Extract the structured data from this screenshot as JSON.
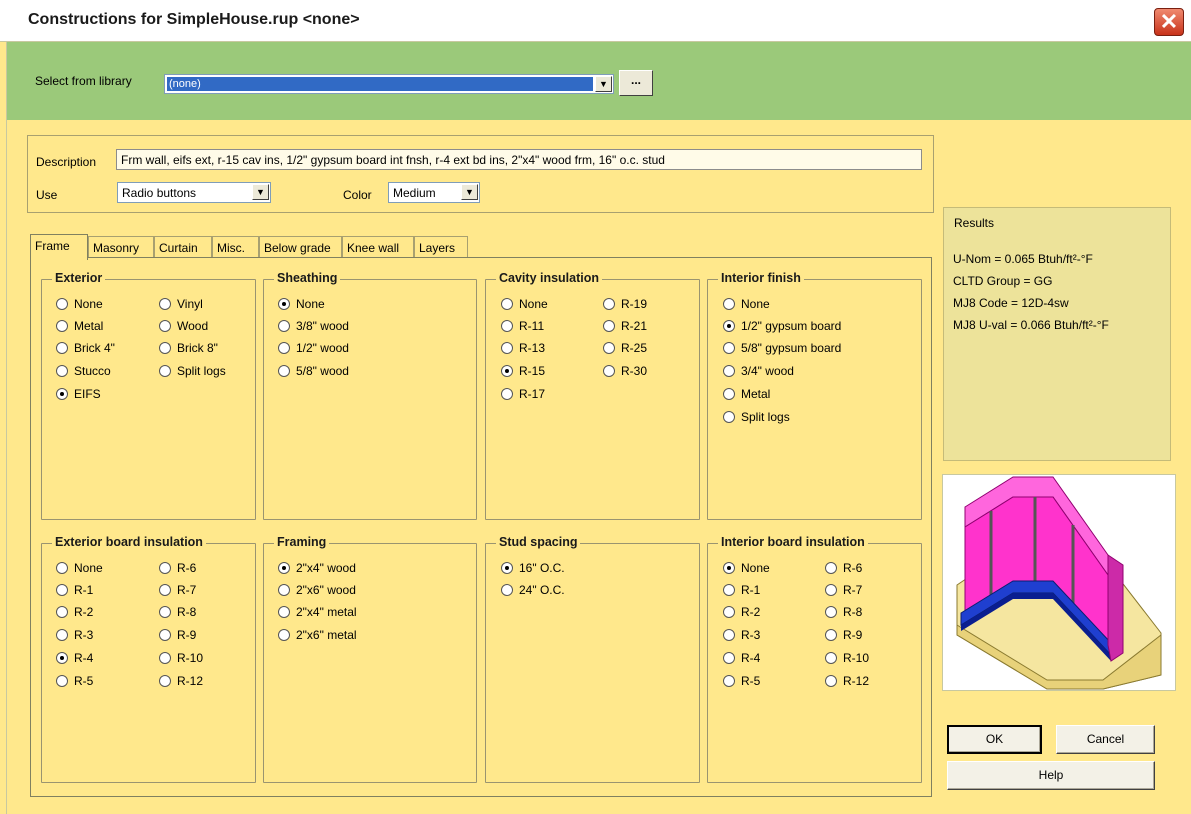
{
  "window": {
    "title": "Constructions for SimpleHouse.rup <none>",
    "close_glyph": "✕"
  },
  "library": {
    "label": "Select from library",
    "value": "(none)",
    "browse_label": "..."
  },
  "description": {
    "label": "Description",
    "value": "Frm wall, eifs ext, r-15 cav ins, 1/2\" gypsum board int fnsh, r-4 ext bd ins, 2\"x4\" wood frm, 16\" o.c. stud"
  },
  "use": {
    "label": "Use",
    "value": "Radio buttons"
  },
  "color": {
    "label": "Color",
    "value": "Medium"
  },
  "tabs": [
    {
      "label": "Frame",
      "active": true
    },
    {
      "label": "Masonry"
    },
    {
      "label": "Curtain"
    },
    {
      "label": "Misc."
    },
    {
      "label": "Below grade"
    },
    {
      "label": "Knee wall"
    },
    {
      "label": "Layers"
    }
  ],
  "groups": {
    "exterior": {
      "title": "Exterior",
      "col1": [
        {
          "label": "None"
        },
        {
          "label": "Metal"
        },
        {
          "label": "Brick 4\""
        },
        {
          "label": "Stucco"
        },
        {
          "label": "EIFS",
          "checked": true
        }
      ],
      "col2": [
        {
          "label": "Vinyl"
        },
        {
          "label": "Wood"
        },
        {
          "label": "Brick 8\""
        },
        {
          "label": "Split logs"
        }
      ]
    },
    "sheathing": {
      "title": "Sheathing",
      "col1": [
        {
          "label": "None",
          "checked": true
        },
        {
          "label": "3/8\" wood"
        },
        {
          "label": "1/2\" wood"
        },
        {
          "label": "5/8\" wood"
        }
      ]
    },
    "cavity": {
      "title": "Cavity insulation",
      "col1": [
        {
          "label": "None"
        },
        {
          "label": "R-11"
        },
        {
          "label": "R-13"
        },
        {
          "label": "R-15",
          "checked": true
        },
        {
          "label": "R-17"
        }
      ],
      "col2": [
        {
          "label": "R-19"
        },
        {
          "label": "R-21"
        },
        {
          "label": "R-25"
        },
        {
          "label": "R-30"
        }
      ]
    },
    "interior_finish": {
      "title": "Interior finish",
      "col1": [
        {
          "label": "None"
        },
        {
          "label": "1/2\" gypsum board",
          "checked": true
        },
        {
          "label": "5/8\" gypsum board"
        },
        {
          "label": "3/4\" wood"
        },
        {
          "label": "Metal"
        },
        {
          "label": "Split logs"
        }
      ]
    },
    "ext_board": {
      "title": "Exterior board insulation",
      "col1": [
        {
          "label": "None"
        },
        {
          "label": "R-1"
        },
        {
          "label": "R-2"
        },
        {
          "label": "R-3"
        },
        {
          "label": "R-4",
          "checked": true
        },
        {
          "label": "R-5"
        }
      ],
      "col2": [
        {
          "label": "R-6"
        },
        {
          "label": "R-7"
        },
        {
          "label": "R-8"
        },
        {
          "label": "R-9"
        },
        {
          "label": "R-10"
        },
        {
          "label": "R-12"
        }
      ]
    },
    "framing": {
      "title": "Framing",
      "col1": [
        {
          "label": "2\"x4\" wood",
          "checked": true
        },
        {
          "label": "2\"x6\" wood"
        },
        {
          "label": "2\"x4\" metal"
        },
        {
          "label": "2\"x6\" metal"
        }
      ]
    },
    "stud": {
      "title": "Stud spacing",
      "col1": [
        {
          "label": "16\" O.C.",
          "checked": true
        },
        {
          "label": "24\" O.C."
        }
      ]
    },
    "int_board": {
      "title": "Interior board insulation",
      "col1": [
        {
          "label": "None",
          "checked": true
        },
        {
          "label": "R-1"
        },
        {
          "label": "R-2"
        },
        {
          "label": "R-3"
        },
        {
          "label": "R-4"
        },
        {
          "label": "R-5"
        }
      ],
      "col2": [
        {
          "label": "R-6"
        },
        {
          "label": "R-7"
        },
        {
          "label": "R-8"
        },
        {
          "label": "R-9"
        },
        {
          "label": "R-10"
        },
        {
          "label": "R-12"
        }
      ]
    }
  },
  "results": {
    "title": "Results",
    "lines": [
      "U-Nom = 0.065 Btuh/ft²-°F",
      "CLTD Group = GG",
      "MJ8 Code = 12D-4sw",
      "MJ8 U-val = 0.066 Btuh/ft²-°F"
    ]
  },
  "buttons": {
    "ok": "OK",
    "cancel": "Cancel",
    "help": "Help"
  },
  "colors": {
    "background": "#ffe88c",
    "library_band": "#9bc97a",
    "results_panel": "#ede39a",
    "selection": "#316ac5",
    "insulation": "#ff33cc",
    "board": "#1f3fd0",
    "sand": "#f5e6a0"
  }
}
